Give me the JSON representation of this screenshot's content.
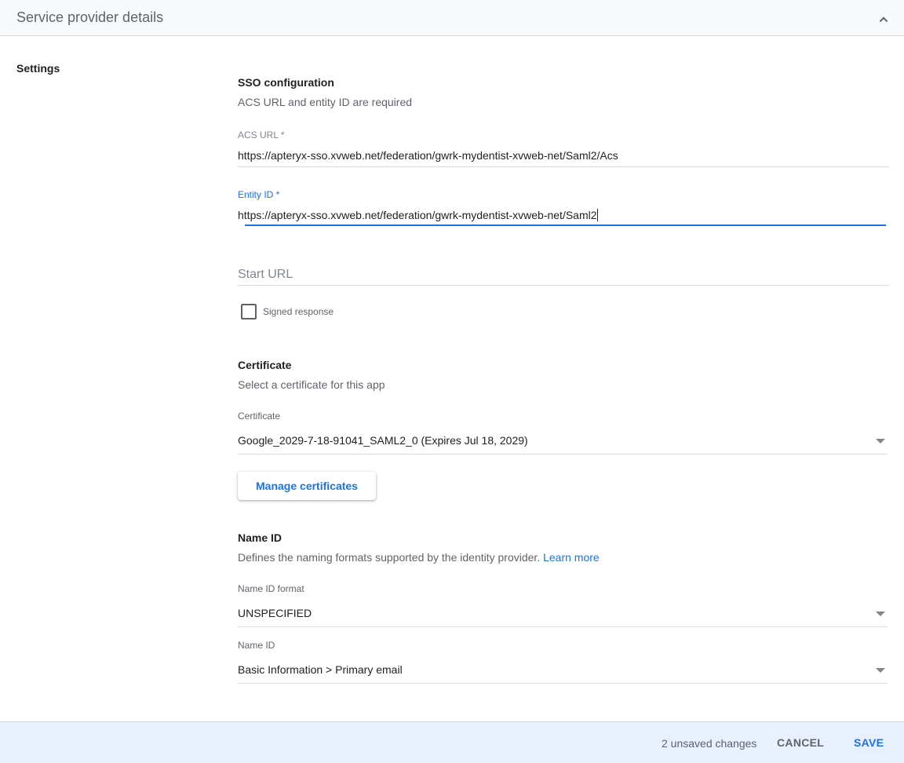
{
  "header": {
    "title": "Service provider details",
    "collapse_icon": "chevron-up-icon"
  },
  "settings_label": "Settings",
  "sso": {
    "title": "SSO configuration",
    "description": "ACS URL and entity ID are required",
    "acs_url": {
      "label": "ACS URL *",
      "value": "https://apteryx-sso.xvweb.net/federation/gwrk-mydentist-xvweb-net/Saml2/Acs"
    },
    "entity_id": {
      "label": "Entity ID *",
      "value": "https://apteryx-sso.xvweb.net/federation/gwrk-mydentist-xvweb-net/Saml2"
    },
    "start_url": {
      "placeholder": "Start URL",
      "value": ""
    },
    "signed_response": {
      "label": "Signed response",
      "checked": false
    }
  },
  "certificate": {
    "title": "Certificate",
    "description": "Select a certificate for this app",
    "field_label": "Certificate",
    "selected": "Google_2029-7-18-91041_SAML2_0 (Expires Jul 18, 2029)",
    "manage_button": "Manage certificates"
  },
  "name_id": {
    "title": "Name ID",
    "description": "Defines the naming formats supported by the identity provider.",
    "learn_more": "Learn more",
    "format_label": "Name ID format",
    "format_value": "UNSPECIFIED",
    "name_id_label": "Name ID",
    "name_id_value": "Basic Information > Primary email"
  },
  "footer": {
    "unsaved_text": "2 unsaved changes",
    "cancel_label": "CANCEL",
    "save_label": "SAVE"
  },
  "colors": {
    "accent": "#1a73e8",
    "footer_bg": "#e8f0fe"
  }
}
